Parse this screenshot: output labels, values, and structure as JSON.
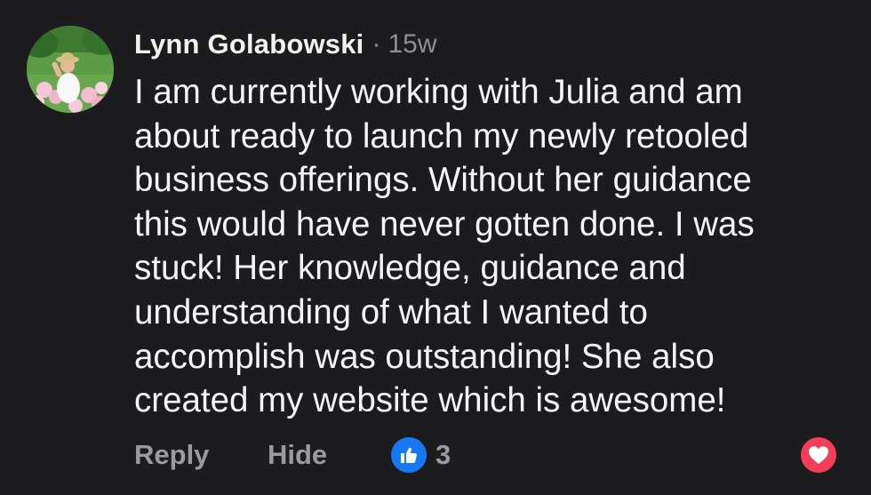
{
  "comment": {
    "author": "Lynn Golabowski",
    "separator": "·",
    "timestamp": "15w",
    "text": "I am currently working with Julia and am\nabout ready to launch my newly retooled\nbusiness offerings. Without her guidance\nthis would have never gotten done. I was\nstuck!  Her knowledge, guidance and\nunderstanding of what I wanted to\naccomplish was outstanding! She also\ncreated my website which is awesome!"
  },
  "actions": {
    "reply_label": "Reply",
    "hide_label": "Hide",
    "like_count": "3"
  },
  "icons": {
    "avatar": "profile-photo",
    "like": "thumbs-up-icon",
    "reaction": "heart-icon"
  },
  "colors": {
    "background": "#1c1c1e",
    "like_blue": "#1877f2",
    "heart_red": "#f33e58",
    "secondary_text": "#9a9aa0"
  }
}
